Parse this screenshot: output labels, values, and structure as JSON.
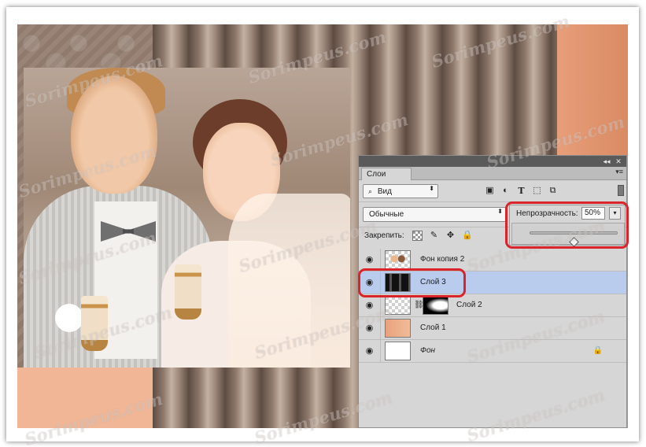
{
  "panel": {
    "tab_label": "Слои",
    "collapse_glyph": "◂◂",
    "close_glyph": "✕",
    "menu_glyph": "▾≡"
  },
  "filter": {
    "search_glyph": "⌕",
    "kind_value": "Вид",
    "spin_glyph": "⬍",
    "icons": [
      "image-filter-icon",
      "adjustment-filter-icon",
      "type-filter-icon",
      "shape-filter-icon",
      "smart-object-filter-icon"
    ],
    "image_glyph": "▣",
    "adjust_glyph": "◐",
    "type_glyph": "T",
    "shape_glyph": "⬚",
    "smart_glyph": "⧉"
  },
  "blend": {
    "mode_value": "Обычные",
    "spin_glyph": "⬍"
  },
  "opacity": {
    "label": "Непрозрачность:",
    "value": "50%",
    "dropdown_glyph": "▾",
    "slider_fraction": 0.5
  },
  "lock": {
    "label": "Закрепить:",
    "paint_glyph": "✎",
    "move_glyph": "✥",
    "all_glyph": "🔒"
  },
  "layers": [
    {
      "name": "Фон копия 2",
      "eye_glyph": "◉",
      "italic": false,
      "selected": false
    },
    {
      "name": "Слой 3",
      "eye_glyph": "◉",
      "italic": false,
      "selected": true
    },
    {
      "name": "Слой 2",
      "eye_glyph": "◉",
      "italic": false,
      "selected": false,
      "link_glyph": "⛓"
    },
    {
      "name": "Слой 1",
      "eye_glyph": "◉",
      "italic": false,
      "selected": false
    },
    {
      "name": "Фон",
      "eye_glyph": "◉",
      "italic": true,
      "selected": false,
      "lock_glyph": "🔒"
    }
  ],
  "watermark": {
    "text": "Sorimpeus.com"
  },
  "colors": {
    "highlight": "#d8242a",
    "selected_row": "#b9ccee"
  }
}
